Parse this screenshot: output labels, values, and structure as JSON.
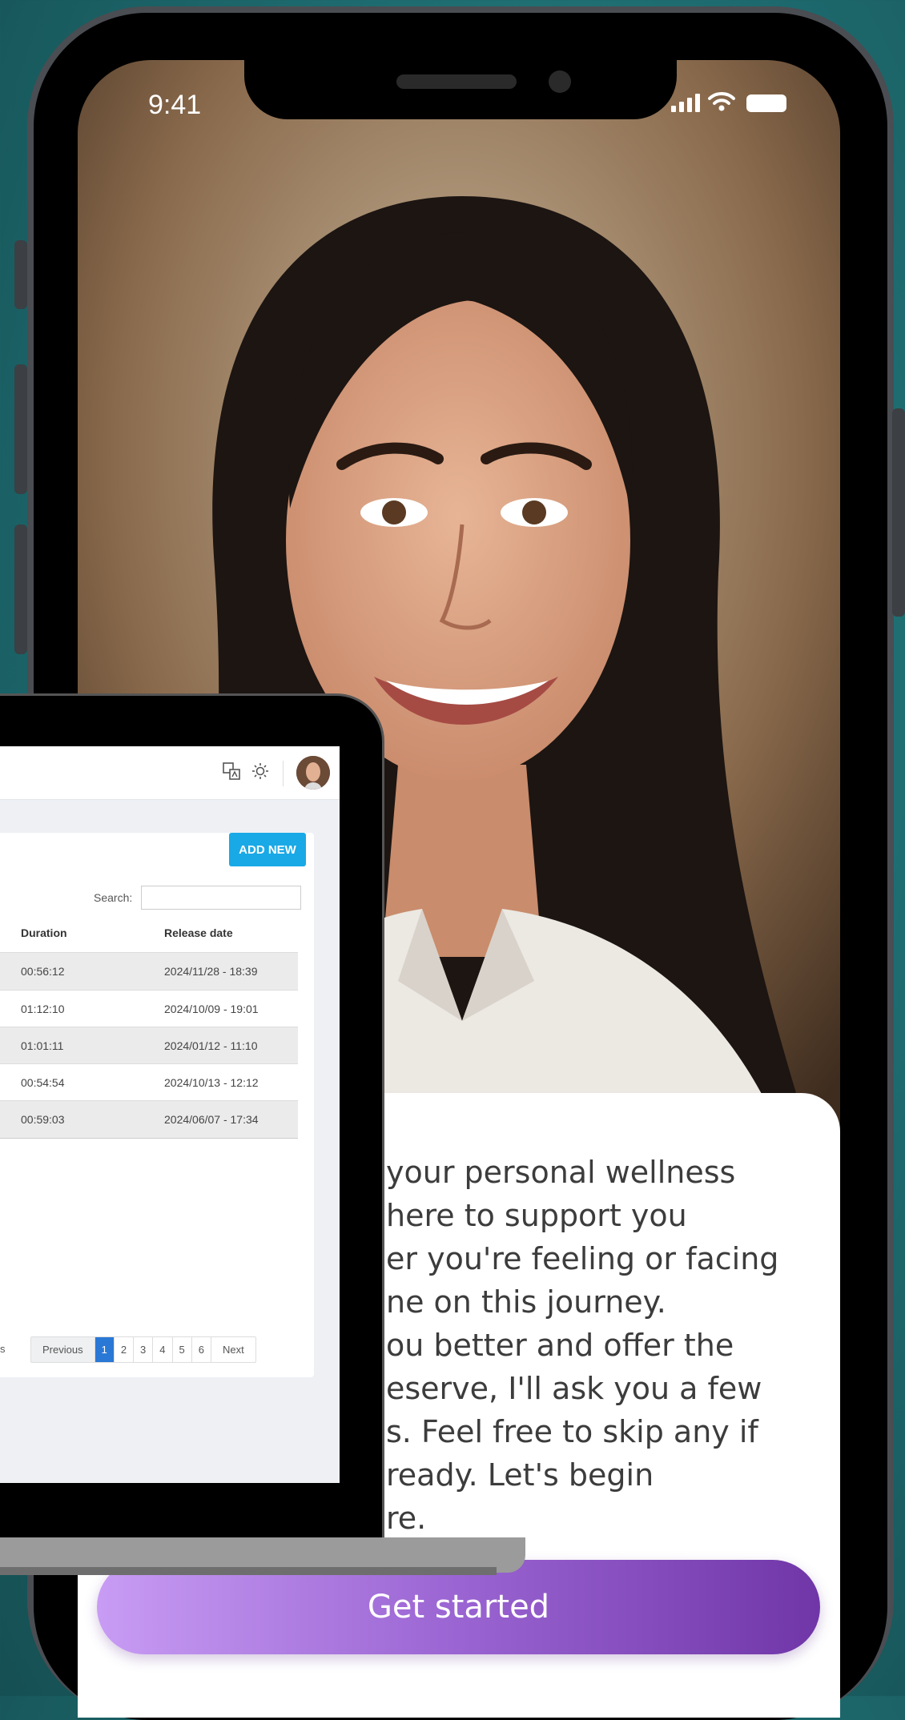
{
  "status_bar": {
    "time": "9:41"
  },
  "welcome_card": {
    "lines": [
      "your personal wellness",
      "here to support you",
      "er you're feeling or facing",
      "ne on this journey.",
      "ou better and offer the",
      "eserve, I'll ask you a few",
      "s. Feel free to skip any if",
      "ready. Let's begin",
      "re."
    ],
    "cta_label": "Get started"
  },
  "dashboard": {
    "add_new_label": "ADD NEW",
    "search_label": "Search:",
    "search_value": "",
    "columns": [
      "Duration",
      "Release date"
    ],
    "rows": [
      {
        "duration": "00:56:12",
        "release": "2024/11/28 - 18:39"
      },
      {
        "duration": "01:12:10",
        "release": "2024/10/09 - 19:01"
      },
      {
        "duration": "01:01:11",
        "release": "2024/01/12 - 11:10"
      },
      {
        "duration": "00:54:54",
        "release": "2024/10/13 - 12:12"
      },
      {
        "duration": "00:59:03",
        "release": "2024/06/07 - 17:34"
      }
    ],
    "pagination": {
      "left_fragment": "s",
      "previous": "Previous",
      "pages": [
        "1",
        "2",
        "3",
        "4",
        "5",
        "6"
      ],
      "active_page": "1",
      "next": "Next"
    },
    "icons": [
      "translate-icon",
      "sun-icon",
      "avatar"
    ]
  },
  "colors": {
    "background": "#1f6f73",
    "accent_button": "#19a9e6",
    "cta_gradient_start": "#c89cf4",
    "cta_gradient_end": "#7036a8",
    "pager_active": "#2a78d6"
  }
}
